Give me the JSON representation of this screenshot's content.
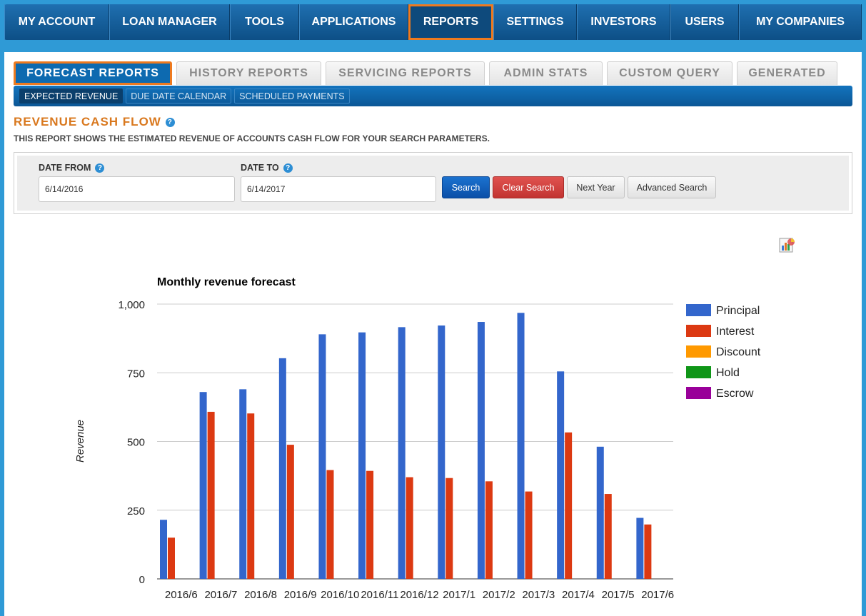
{
  "nav": {
    "items": [
      {
        "label": "MY ACCOUNT"
      },
      {
        "label": "LOAN MANAGER"
      },
      {
        "label": "TOOLS"
      },
      {
        "label": "APPLICATIONS"
      },
      {
        "label": "REPORTS"
      },
      {
        "label": "SETTINGS"
      },
      {
        "label": "INVESTORS"
      },
      {
        "label": "USERS"
      },
      {
        "label": "MY COMPANIES"
      }
    ],
    "active": "REPORTS"
  },
  "tabs": [
    {
      "label": "FORECAST REPORTS"
    },
    {
      "label": "HISTORY REPORTS"
    },
    {
      "label": "SERVICING REPORTS"
    },
    {
      "label": "ADMIN STATS"
    },
    {
      "label": "CUSTOM QUERY"
    },
    {
      "label": "GENERATED"
    }
  ],
  "subtabs": [
    {
      "label": "EXPECTED REVENUE"
    },
    {
      "label": "DUE DATE CALENDAR"
    },
    {
      "label": "SCHEDULED PAYMENTS"
    }
  ],
  "report": {
    "title": "REVENUE CASH FLOW",
    "description": "THIS REPORT SHOWS THE ESTIMATED REVENUE OF ACCOUNTS CASH FLOW FOR YOUR SEARCH PARAMETERS."
  },
  "search": {
    "date_from_label": "DATE FROM",
    "date_from_value": "6/14/2016",
    "date_to_label": "DATE TO",
    "date_to_value": "6/14/2017",
    "search_label": "Search",
    "clear_label": "Clear Search",
    "next_year_label": "Next Year",
    "advanced_label": "Advanced Search"
  },
  "icons": {
    "help": "?",
    "export": "chart-export-icon"
  },
  "colors": {
    "accent": "#ee7a1f",
    "nav": "#0d4f86",
    "principal": "#3366cc",
    "interest": "#dc3912",
    "discount": "#ff9900",
    "hold": "#109618",
    "escrow": "#990099"
  },
  "chart_data": {
    "type": "bar",
    "title": "Monthly revenue forecast",
    "xlabel": "",
    "ylabel": "Revenue",
    "ylim": [
      0,
      1000
    ],
    "yticks": [
      "0",
      "250",
      "500",
      "750",
      "1,000"
    ],
    "categories": [
      "2016/6",
      "2016/7",
      "2016/8",
      "2016/9",
      "2016/10",
      "2016/11",
      "2016/12",
      "2017/1",
      "2017/2",
      "2017/3",
      "2017/4",
      "2017/5",
      "2017/6"
    ],
    "series": [
      {
        "name": "Principal",
        "color": "#3366cc",
        "values": [
          215,
          680,
          690,
          803,
          890,
          897,
          916,
          922,
          935,
          968,
          755,
          481,
          222
        ]
      },
      {
        "name": "Interest",
        "color": "#dc3912",
        "values": [
          150,
          608,
          602,
          488,
          396,
          393,
          370,
          367,
          355,
          318,
          533,
          309,
          198
        ]
      },
      {
        "name": "Discount",
        "color": "#ff9900",
        "values": [
          0,
          0,
          0,
          0,
          0,
          0,
          0,
          0,
          0,
          0,
          0,
          0,
          0
        ]
      },
      {
        "name": "Hold",
        "color": "#109618",
        "values": [
          0,
          0,
          0,
          0,
          0,
          0,
          0,
          0,
          0,
          0,
          0,
          0,
          0
        ]
      },
      {
        "name": "Escrow",
        "color": "#990099",
        "values": [
          0,
          0,
          0,
          0,
          0,
          0,
          0,
          0,
          0,
          0,
          0,
          0,
          0
        ]
      }
    ],
    "legend": "right",
    "grid": true
  }
}
